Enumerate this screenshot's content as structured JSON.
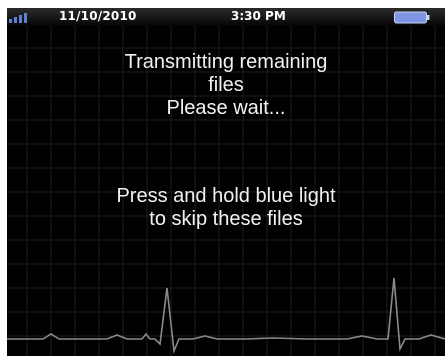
{
  "status": {
    "date": "11/10/2010",
    "time": "3:30 PM"
  },
  "message": {
    "line1": "Transmitting remaining",
    "line2": "files",
    "line3": "Please wait...",
    "line4": "Press and hold blue light",
    "line5": "to skip these files"
  }
}
